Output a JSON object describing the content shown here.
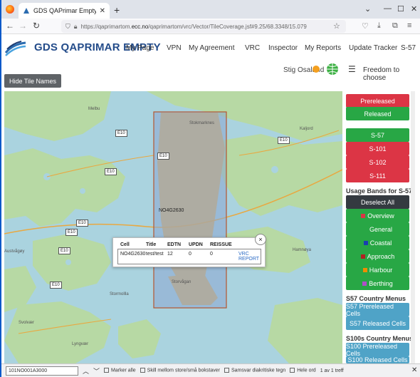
{
  "browser": {
    "tab_title": "GDS QAPrimar Empty - Vector",
    "url_prefix": "https://qaprimartom.",
    "url_domain": "ecc.no",
    "url_rest": "/qaprimartom/vrc/Vector/TileCoverage.jsf#9.25/68.3348/15.079"
  },
  "app": {
    "brand": "GDS QAPRIMAR EMPTY",
    "menu": [
      "My Page",
      "VPN",
      "My Agreement",
      "VRC",
      "Inspector",
      "My Reports",
      "Update Tracker",
      "S-57"
    ],
    "user": "Stig Osaland",
    "freedom": "Freedom to choose",
    "hide_tile_names": "Hide Tile Names"
  },
  "map": {
    "cell_label": "NO4G2630",
    "places": [
      "Melbu",
      "Stokmarknes",
      "Svolvær",
      "Austvågøy",
      "Stormollla",
      "Lyngvær",
      "Storvågan",
      "Hamnøya",
      "Kaljord"
    ],
    "routes": [
      "E10",
      "E10",
      "E10",
      "E10",
      "E10",
      "E10",
      "E10",
      "E10"
    ]
  },
  "popup": {
    "headers": [
      "Cell",
      "Title",
      "EDTN",
      "UPDN",
      "REISSUE"
    ],
    "row": [
      "NO4G2630",
      "test/test",
      "12",
      "0",
      "0"
    ],
    "link1": "VRC",
    "link2": "REPORT",
    "close": "×"
  },
  "side": {
    "prereleased": "Prereleased",
    "released": "Released",
    "products": [
      "S-57",
      "S-101",
      "S-102",
      "S-111"
    ],
    "usage_heading": "Usage Bands for S-57",
    "deselect": "Deselect All",
    "bands": [
      {
        "label": "Overview",
        "color": "#dc3545"
      },
      {
        "label": "General",
        "color": "#28a745"
      },
      {
        "label": "Coastal",
        "color": "#1a3fb0"
      },
      {
        "label": "Approach",
        "color": "#b22222"
      },
      {
        "label": "Harbour",
        "color": "#f08c00"
      },
      {
        "label": "Berthing",
        "color": "#b04fc8"
      }
    ],
    "s57_heading": "S57 Country Menus",
    "s57_pre": "S57 Prereleased Cells",
    "s57_rel": "S57 Released Cells",
    "s100_heading": "S100s Country Menus",
    "s100_pre": "S100 Prereleased Cells",
    "s100_rel": "S100 Released Cells"
  },
  "findbar": {
    "value": "101NO001A3000",
    "match_all": "Marker alle",
    "case": "Skill mellom store/små bokstaver",
    "diacritics": "Samsvar diakritiske tegn",
    "whole": "Hele ord",
    "count": "1 av 1 treff"
  }
}
